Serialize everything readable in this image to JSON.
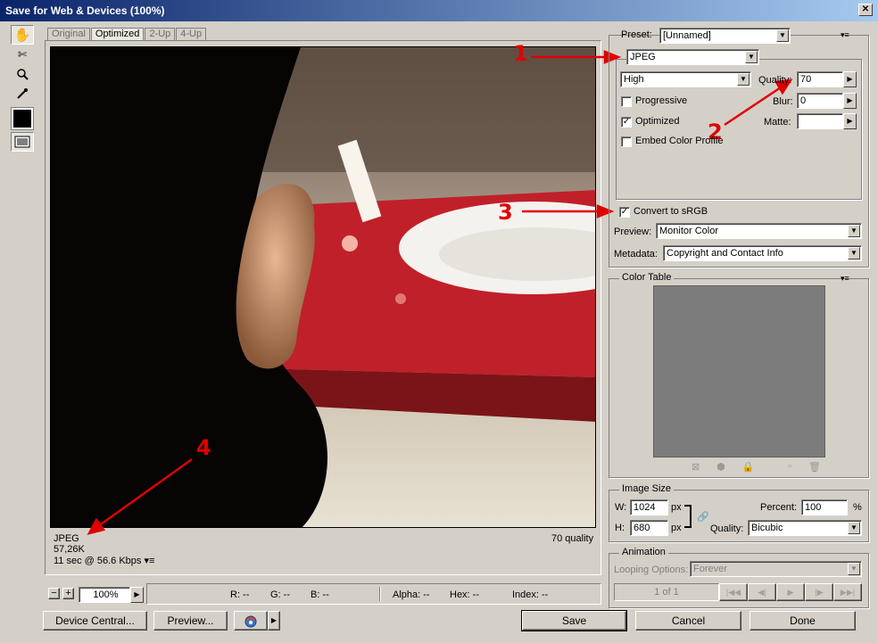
{
  "window": {
    "title": "Save for Web & Devices (100%)"
  },
  "tabs": [
    "Original",
    "Optimized",
    "2-Up",
    "4-Up"
  ],
  "preview_info": {
    "format": "JPEG",
    "size": "57,26K",
    "time": "11 sec @ 56.6 Kbps",
    "quality": "70 quality"
  },
  "preset": {
    "label": "Preset:",
    "value": "[Unnamed]"
  },
  "format": {
    "value": "JPEG"
  },
  "compression": {
    "value": "High"
  },
  "quality": {
    "label": "Quality:",
    "value": "70"
  },
  "blur": {
    "label": "Blur:",
    "value": "0"
  },
  "matte": {
    "label": "Matte:",
    "value": ""
  },
  "checkboxes": {
    "progressive": "Progressive",
    "optimized": "Optimized",
    "embed": "Embed Color Profile",
    "convert": "Convert to sRGB"
  },
  "preview_mode": {
    "label": "Preview:",
    "value": "Monitor Color"
  },
  "metadata": {
    "label": "Metadata:",
    "value": "Copyright and Contact Info"
  },
  "color_table": {
    "title": "Color Table"
  },
  "image_size": {
    "title": "Image Size",
    "w_label": "W:",
    "w": "1024",
    "h_label": "H:",
    "h": "680",
    "unit": "px",
    "percent_label": "Percent:",
    "percent": "100",
    "pct": "%",
    "quality_label": "Quality:",
    "quality": "Bicubic"
  },
  "animation": {
    "title": "Animation",
    "looping_label": "Looping Options:",
    "looping": "Forever",
    "frame": "1 of 1"
  },
  "statusbar": {
    "zoom": "100%",
    "r": "R: --",
    "g": "G: --",
    "b": "B: --",
    "alpha": "Alpha: --",
    "hex": "Hex: --",
    "index": "Index: --"
  },
  "buttons": {
    "device_central": "Device Central...",
    "preview": "Preview...",
    "save": "Save",
    "cancel": "Cancel",
    "done": "Done"
  },
  "annotations": [
    "1",
    "2",
    "3",
    "4"
  ],
  "colors": {
    "annotation": "#e00000",
    "titlebar": "#0a246a",
    "face": "#d4d0c8"
  }
}
